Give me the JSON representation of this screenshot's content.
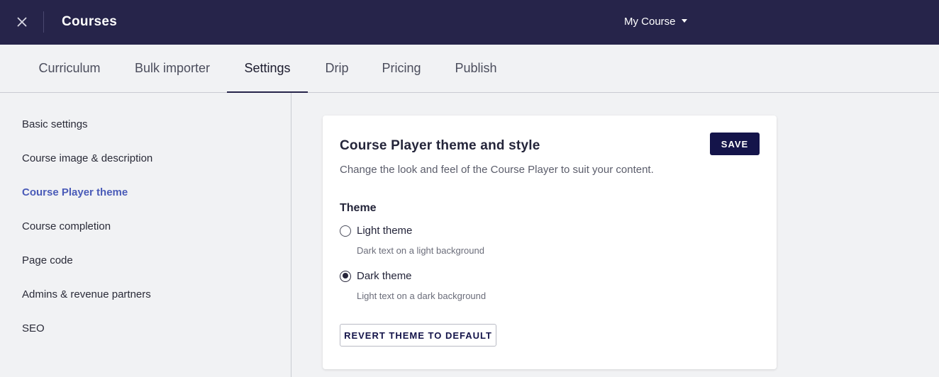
{
  "header": {
    "title": "Courses",
    "course_selector": "My Course",
    "close_icon": "close-icon",
    "caret_icon": "caret-down-icon",
    "background": "#26244a"
  },
  "tabs": [
    {
      "label": "Curriculum",
      "active": false
    },
    {
      "label": "Bulk importer",
      "active": false
    },
    {
      "label": "Settings",
      "active": true
    },
    {
      "label": "Drip",
      "active": false
    },
    {
      "label": "Pricing",
      "active": false
    },
    {
      "label": "Publish",
      "active": false
    }
  ],
  "sidebar": {
    "items": [
      {
        "label": "Basic settings",
        "active": false
      },
      {
        "label": "Course image & description",
        "active": false
      },
      {
        "label": "Course Player theme",
        "active": true
      },
      {
        "label": "Course completion",
        "active": false
      },
      {
        "label": "Page code",
        "active": false
      },
      {
        "label": "Admins & revenue partners",
        "active": false
      },
      {
        "label": "SEO",
        "active": false
      }
    ],
    "active_color": "#4a5bb8"
  },
  "card": {
    "title": "Course Player theme and style",
    "description": "Change the look and feel of the Course Player to suit your content.",
    "save_label": "SAVE",
    "theme_label": "Theme",
    "options": [
      {
        "label": "Light theme",
        "hint": "Dark text on a light background",
        "checked": false
      },
      {
        "label": "Dark theme",
        "hint": "Light text on a dark background",
        "checked": true
      }
    ],
    "revert_label": "REVERT THEME TO DEFAULT",
    "button_color": "#14144a"
  }
}
